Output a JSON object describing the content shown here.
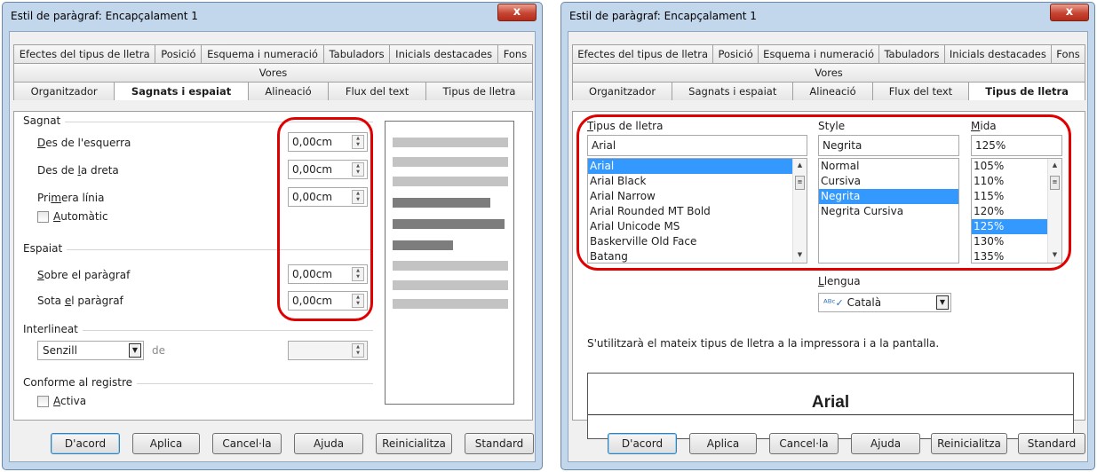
{
  "dialog1": {
    "title": "Estil de paràgraf: Encapçalament 1",
    "close_glyph": "x",
    "tabs_row1": [
      "Efectes del tipus de lletra",
      "Posició",
      "Esquema i numeració",
      "Tabuladors",
      "Inicials destacades",
      "Fons"
    ],
    "tabs_row2": [
      "Vores"
    ],
    "tabs_row3": [
      "Organitzador",
      "Sagnats i espaiat",
      "Alineació",
      "Flux del text",
      "Tipus de lletra"
    ],
    "active_tab": "Sagnats i espaiat",
    "indent": {
      "group": "Sagnat",
      "from_left_label": "Des de l'esquerra",
      "from_left_value": "0,00cm",
      "from_right_label": "Des de la dreta",
      "from_right_value": "0,00cm",
      "first_line_label": "Primera línia",
      "first_line_value": "0,00cm",
      "automatic_label": "Automàtic"
    },
    "spacing": {
      "group": "Espaiat",
      "above_label": "Sobre el paràgraf",
      "above_value": "0,00cm",
      "below_label": "Sota el paràgraf",
      "below_value": "0,00cm"
    },
    "line_spacing": {
      "group": "Interlineat",
      "value": "Senzill",
      "of_label": "de"
    },
    "register": {
      "group": "Conforme al registre",
      "active_label": "Activa"
    }
  },
  "dialog2": {
    "title": "Estil de paràgraf: Encapçalament 1",
    "close_glyph": "x",
    "tabs_row1": [
      "Efectes del tipus de lletra",
      "Posició",
      "Esquema i numeració",
      "Tabuladors",
      "Inicials destacades",
      "Fons"
    ],
    "tabs_row2": [
      "Vores"
    ],
    "tabs_row3": [
      "Organitzador",
      "Sagnats i espaiat",
      "Alineació",
      "Flux del text",
      "Tipus de lletra"
    ],
    "active_tab": "Tipus de lletra",
    "font": {
      "label": "Tipus de lletra",
      "value": "Arial",
      "options": [
        "Arial",
        "Arial Black",
        "Arial Narrow",
        "Arial Rounded MT Bold",
        "Arial Unicode MS",
        "Baskerville Old Face",
        "Batang"
      ],
      "selected": "Arial"
    },
    "style": {
      "label": "Style",
      "value": "Negrita",
      "options": [
        "Normal",
        "Cursiva",
        "Negrita",
        "Negrita Cursiva"
      ],
      "selected": "Negrita"
    },
    "size": {
      "label": "Mida",
      "value": "125%",
      "options": [
        "105%",
        "110%",
        "115%",
        "120%",
        "125%",
        "130%",
        "135%"
      ],
      "selected": "125%"
    },
    "language": {
      "label": "Llengua",
      "value": "Català"
    },
    "info_text": "S'utilitzarà el mateix tipus de lletra a la impressora i a la pantalla.",
    "preview_text": "Arial"
  },
  "buttons": {
    "ok": "D'acord",
    "apply": "Aplica",
    "cancel": "Cancel·la",
    "help": "Ajuda",
    "reset": "Reinicialitza",
    "standard": "Standard"
  },
  "colors": {
    "highlight_oval": "#e00000",
    "selection": "#3399ff",
    "frame": "#c3d7ec"
  }
}
